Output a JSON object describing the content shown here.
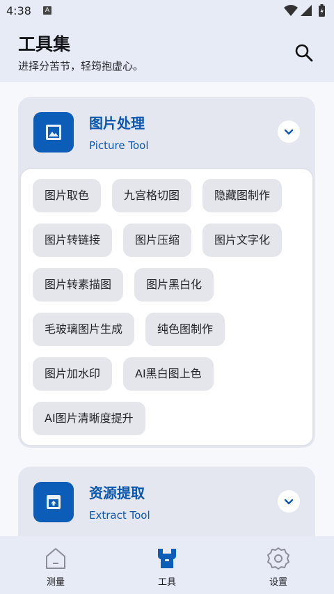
{
  "status_bar": {
    "time": "4:38",
    "sim_label": "A"
  },
  "header": {
    "title": "工具集",
    "subtitle": "进择分苦节，轻筠抱虚心。"
  },
  "sections": [
    {
      "title": "图片处理",
      "subtitle": "Picture Tool",
      "tools": [
        "图片取色",
        "九宫格切图",
        "隐藏图制作",
        "图片转链接",
        "图片压缩",
        "图片文字化",
        "图片转素描图",
        "图片黑白化",
        "毛玻璃图片生成",
        "纯色图制作",
        "图片加水印",
        "AI黑白图上色",
        "AI图片清晰度提升"
      ]
    },
    {
      "title": "资源提取",
      "subtitle": "Extract Tool"
    }
  ],
  "bottom_nav": [
    {
      "label": "测量",
      "icon": "home-icon"
    },
    {
      "label": "工具",
      "icon": "tools-icon",
      "active": true
    },
    {
      "label": "设置",
      "icon": "gear-icon"
    }
  ],
  "colors": {
    "accent": "#0b5db8",
    "header_bg": "#e7ebf6",
    "card_bg": "#e4e7ef",
    "chip_bg": "#e4e6ec"
  }
}
